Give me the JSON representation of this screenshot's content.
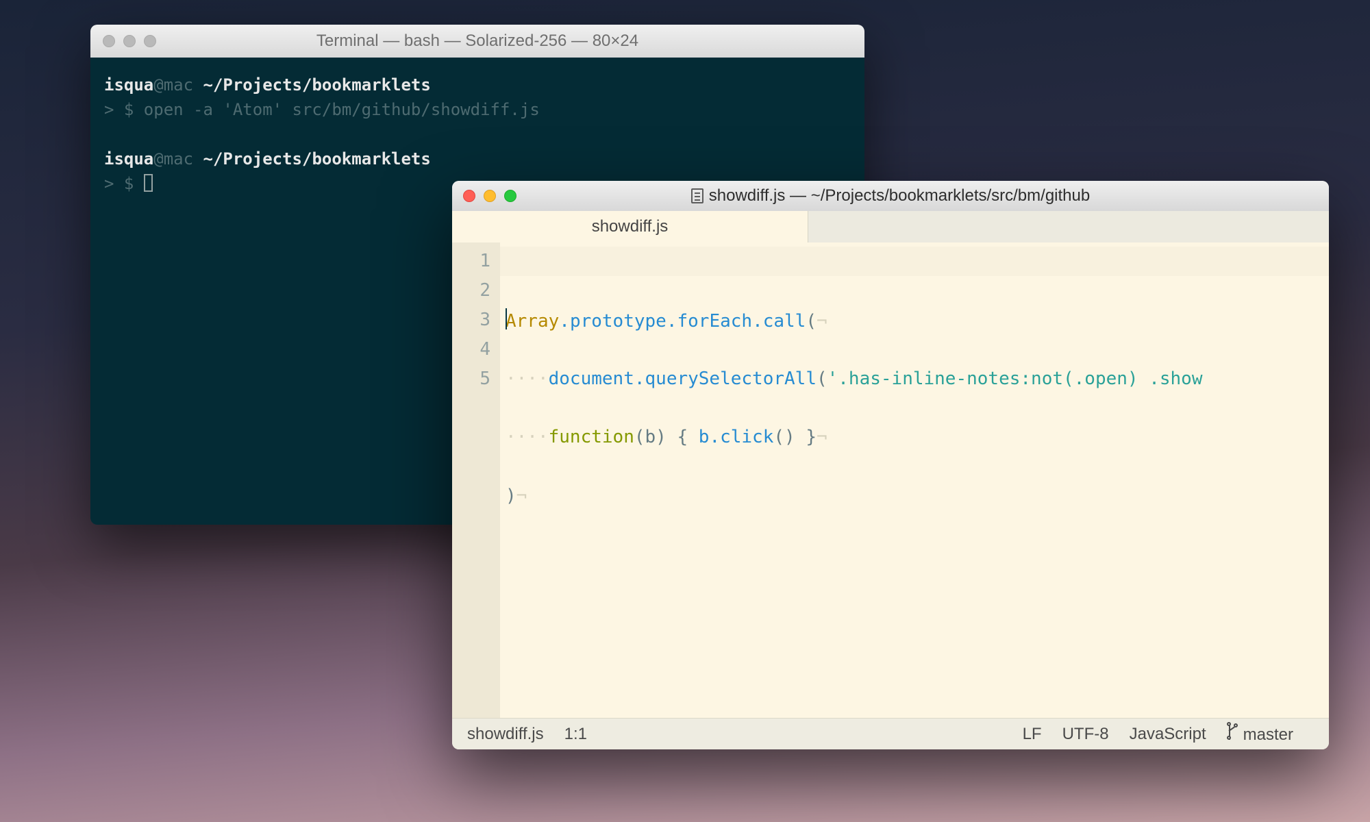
{
  "terminal": {
    "title": "Terminal — bash — Solarized-256 — 80×24",
    "lines": [
      {
        "user": "isqua",
        "at": "@mac",
        "path": "~/Projects/bookmarklets"
      },
      {
        "prompt": "> $ ",
        "cmd": "open -a 'Atom' src/bm/github/showdiff.js"
      },
      {
        "blank": true
      },
      {
        "user": "isqua",
        "at": "@mac",
        "path": "~/Projects/bookmarklets"
      },
      {
        "prompt": "> $ ",
        "cursor": true
      }
    ]
  },
  "editor": {
    "title": "showdiff.js — ~/Projects/bookmarklets/src/bm/github",
    "tab": "showdiff.js",
    "gutter": [
      "1",
      "2",
      "3",
      "4",
      "5"
    ],
    "code": {
      "line1": {
        "a": "Array",
        "dot1": ".",
        "b": "prototype",
        "dot2": ".",
        "c": "forEach",
        "dot3": ".",
        "d": "call",
        "paren": "(",
        "nl": "¬"
      },
      "line2": {
        "indent": "····",
        "a": "document",
        "dot1": ".",
        "b": "querySelectorAll",
        "paren": "(",
        "str": "'.has-inline-notes:not(.open) .show"
      },
      "line3": {
        "indent": "····",
        "kw": "function",
        "p1": "(b) { ",
        "obj": "b",
        "dot": ".",
        "m": "click",
        "p2": "() }",
        "nl": "¬"
      },
      "line4": {
        "paren": ")",
        "nl": "¬"
      }
    },
    "status": {
      "filename": "showdiff.js",
      "cursor": "1:1",
      "eol": "LF",
      "encoding": "UTF-8",
      "lang": "JavaScript",
      "branch": "master"
    }
  }
}
